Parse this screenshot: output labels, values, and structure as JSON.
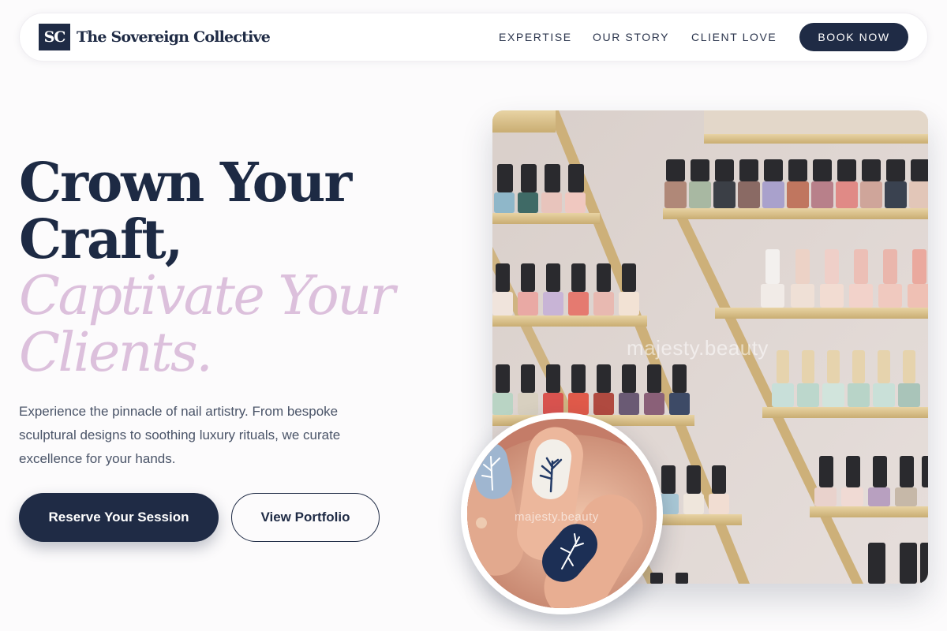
{
  "header": {
    "logo_mark": "SC",
    "brand_name": "The Sovereign Collective",
    "nav": [
      "EXPERTISE",
      "OUR STORY",
      "CLIENT LOVE"
    ],
    "cta_label": "BOOK NOW"
  },
  "hero": {
    "headline_line1": "Crown Your",
    "headline_line2": "Craft,",
    "headline_accent1": "Captivate Your",
    "headline_accent2": "Clients.",
    "lead": "Experience the pinnacle of nail artistry. From bespoke sculptural designs to soothing luxury rituals, we curate excellence for your hands.",
    "primary_button": "Reserve Your Session",
    "secondary_button": "View Portfolio"
  },
  "media": {
    "main_photo_watermark": "majesty.beauty",
    "inset_photo_watermark": "majesty.beauty"
  },
  "colors": {
    "navy": "#1f2b45",
    "accent_lilac": "#dcc0dc",
    "background": "#fcfbfc"
  }
}
